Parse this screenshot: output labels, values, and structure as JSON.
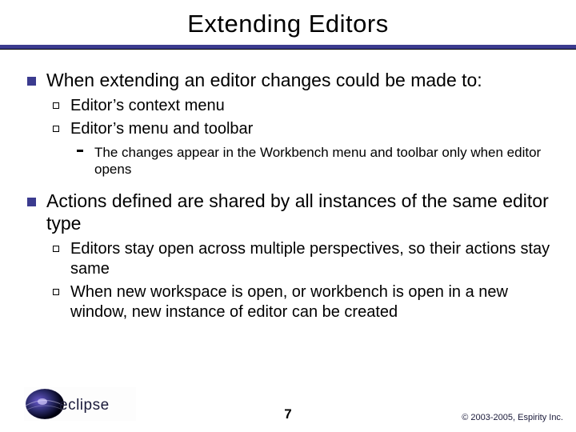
{
  "title": "Extending Editors",
  "bullets": [
    {
      "text": "When extending an editor changes could be made to:",
      "sub": [
        {
          "text": "Editor’s context menu"
        },
        {
          "text": "Editor’s menu and toolbar",
          "sub": [
            {
              "text": "The changes appear in the Workbench menu and toolbar only when editor opens"
            }
          ]
        }
      ]
    },
    {
      "text": "Actions defined are shared by all instances of the same editor type",
      "sub": [
        {
          "text": "Editors stay open across multiple perspectives, so their actions stay same"
        },
        {
          "text": "When new workspace is open, or workbench is open in a new window, new instance of editor can be created"
        }
      ]
    }
  ],
  "logo_text": "eclipse",
  "page_number": "7",
  "copyright": "© 2003-2005, Espirity Inc."
}
